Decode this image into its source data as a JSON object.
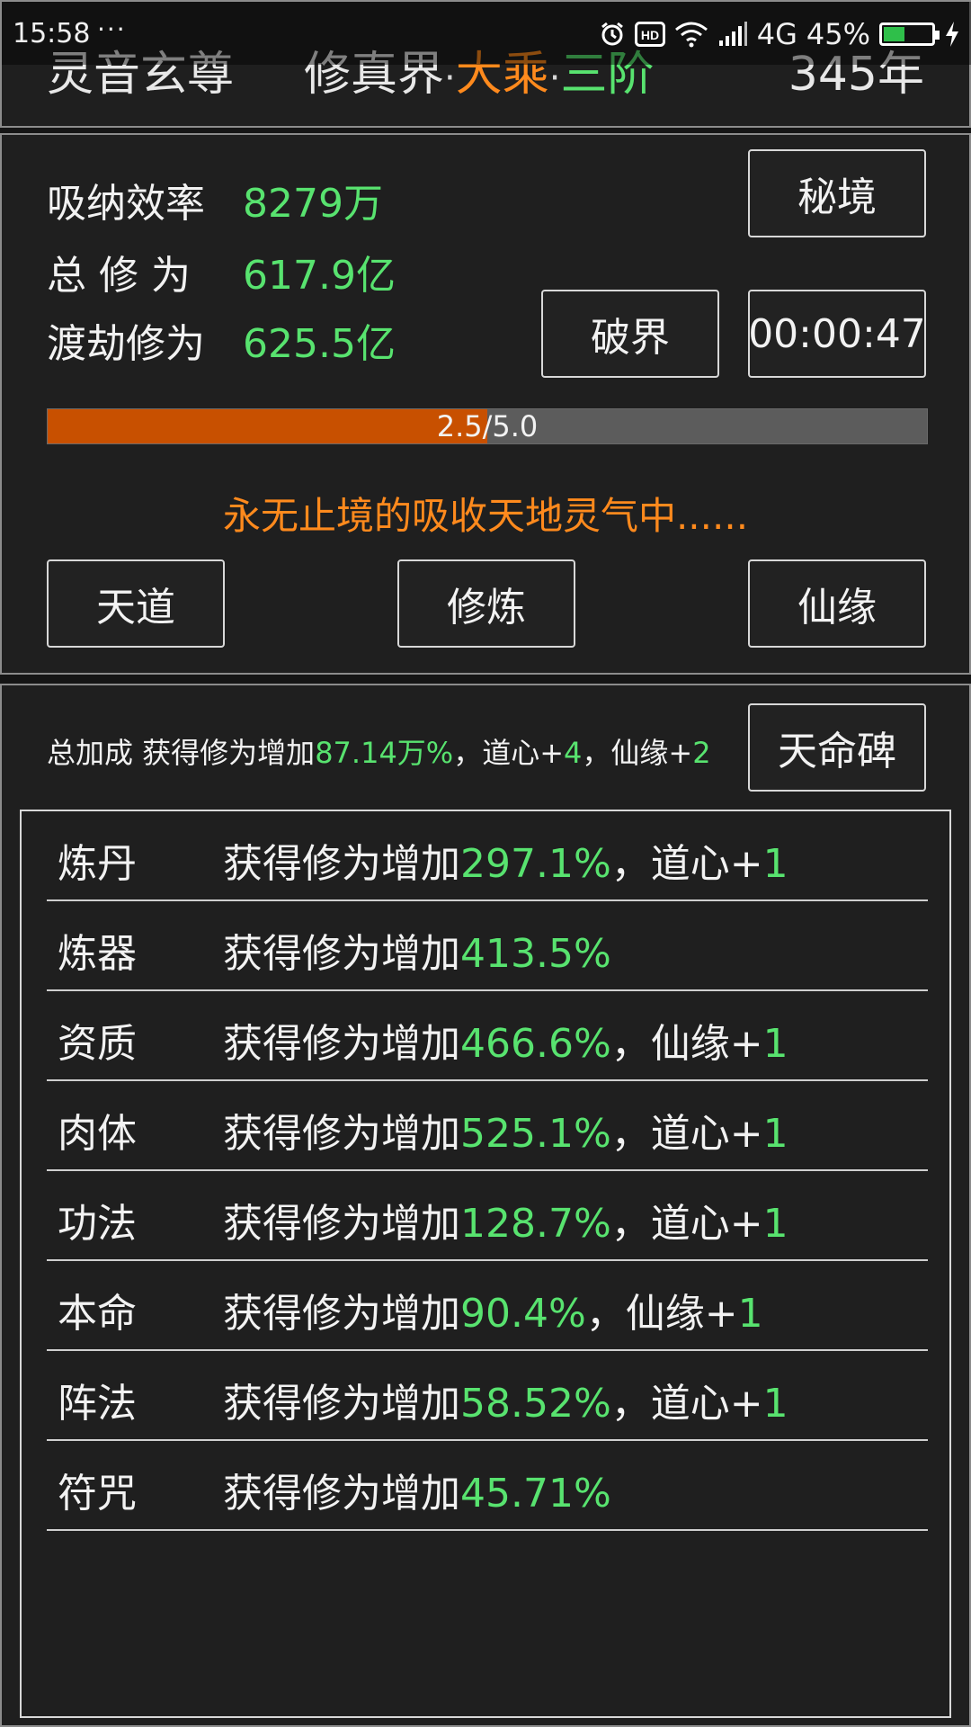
{
  "status_bar": {
    "time": "15:58",
    "notification_dots": "···",
    "network": "4G",
    "battery_percent": "45%",
    "battery_level": 0.45,
    "icons": [
      "alarm-icon",
      "hd-icon",
      "wifi-icon",
      "signal-icon",
      "battery-icon",
      "charging-icon"
    ]
  },
  "header": {
    "character_name": "灵音玄尊",
    "realm_prefix": "修真界",
    "separator": "·",
    "realm_major": "大乘",
    "realm_stage": "三阶",
    "years": "345年"
  },
  "stats": {
    "absorb_label": "吸纳效率",
    "absorb_value": "8279万",
    "total_label": "总 修 为",
    "total_value": "617.9亿",
    "tribulation_label": "渡劫修为",
    "tribulation_value": "625.5亿"
  },
  "buttons": {
    "secret_realm": "秘境",
    "breakthrough": "破界",
    "timer": "00:00:47",
    "heaven_dao": "天道",
    "cultivate": "修炼",
    "immortal_fate": "仙缘",
    "destiny_stele": "天命碑"
  },
  "progress": {
    "label": "2.5/5.0",
    "current": 2.5,
    "max": 5.0
  },
  "status_message": "永无止境的吸收天地灵气中......",
  "bonus_summary": {
    "prefix": "总加成 获得修为增加",
    "percent": "87.14万%",
    "dao_heart_text": "，道心+",
    "dao_heart_value": "4",
    "fate_text": "，仙缘+",
    "fate_value": "2"
  },
  "bonus_list": [
    {
      "name": "炼丹",
      "text": "获得修为增加",
      "percent": "297.1%",
      "extra_label": "，道心+",
      "extra_value": "1"
    },
    {
      "name": "炼器",
      "text": "获得修为增加",
      "percent": "413.5%",
      "extra_label": "",
      "extra_value": ""
    },
    {
      "name": "资质",
      "text": "获得修为增加",
      "percent": "466.6%",
      "extra_label": "，仙缘+",
      "extra_value": "1"
    },
    {
      "name": "肉体",
      "text": "获得修为增加",
      "percent": "525.1%",
      "extra_label": "，道心+",
      "extra_value": "1"
    },
    {
      "name": "功法",
      "text": "获得修为增加",
      "percent": "128.7%",
      "extra_label": "，道心+",
      "extra_value": "1"
    },
    {
      "name": "本命",
      "text": "获得修为增加",
      "percent": "90.4%",
      "extra_label": "，仙缘+",
      "extra_value": "1"
    },
    {
      "name": "阵法",
      "text": "获得修为增加",
      "percent": "58.52%",
      "extra_label": "，道心+",
      "extra_value": "1"
    },
    {
      "name": "符咒",
      "text": "获得修为增加",
      "percent": "45.71%",
      "extra_label": "",
      "extra_value": ""
    }
  ],
  "colors": {
    "accent_green": "#58e36f",
    "accent_orange": "#ff8a1d",
    "progress_fill": "#c85000",
    "background": "#1f1f1f"
  }
}
